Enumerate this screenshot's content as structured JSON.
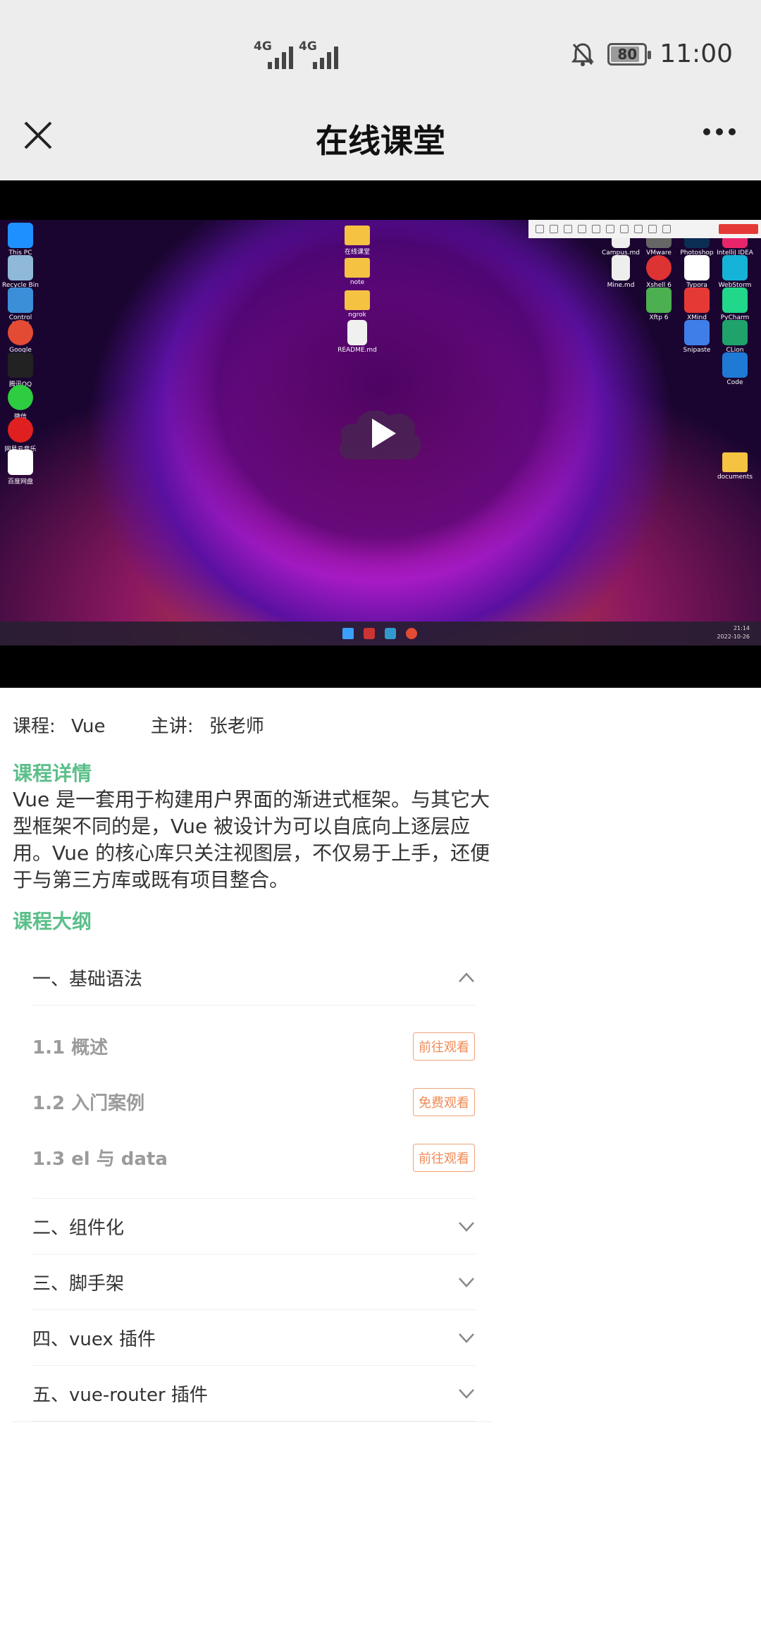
{
  "status_bar": {
    "network_1": "4G",
    "network_2": "4G",
    "battery_level": "80",
    "time": "11:00"
  },
  "header": {
    "title": "在线课堂"
  },
  "course": {
    "course_label": "课程:",
    "course_name": "Vue",
    "teacher_label": "主讲:",
    "teacher_name": "张老师"
  },
  "detail": {
    "title": "课程详情",
    "description": "Vue 是一套用于构建用户界面的渐进式框架。与其它大型框架不同的是，Vue 被设计为可以自底向上逐层应用。Vue 的核心库只关注视图层，不仅易于上手，还便于与第三方库或既有项目整合。"
  },
  "outline": {
    "title": "课程大纲",
    "chapters": [
      {
        "title": "一、基础语法",
        "expanded": true,
        "lessons": [
          {
            "title": "1.1 概述",
            "action": "前往观看"
          },
          {
            "title": "1.2 入门案例",
            "action": "免费观看"
          },
          {
            "title": "1.3 el 与 data",
            "action": "前往观看"
          }
        ]
      },
      {
        "title": "二、组件化",
        "expanded": false
      },
      {
        "title": "三、脚手架",
        "expanded": false
      },
      {
        "title": "四、vuex 插件",
        "expanded": false
      },
      {
        "title": "五、vue-router 插件",
        "expanded": false
      }
    ]
  },
  "video": {
    "desktop_icons_left": [
      "This PC",
      "Recycle Bin",
      "Control Panel",
      "Google Chrome",
      "腾讯QQ",
      "微信",
      "网易云音乐",
      "百度网盘"
    ],
    "desktop_icons_mid": [
      "在线课堂",
      "note",
      "ngrok",
      "README.md"
    ],
    "desktop_icons_right": [
      "Campus.md",
      "VMware",
      "Photoshop",
      "IntelliJ IDEA",
      "Mine.md",
      "Xshell 6",
      "Typora",
      "WebStorm",
      "Xftp 6",
      "XMind",
      "PyCharm",
      "Snipaste",
      "CLion",
      "Code",
      "documents"
    ],
    "taskbar_time": "21:14",
    "taskbar_date": "2022-10-26"
  },
  "colors": {
    "accent_green": "#5bbf8a",
    "button_orange": "#f08a55",
    "header_bg": "#ededed"
  }
}
